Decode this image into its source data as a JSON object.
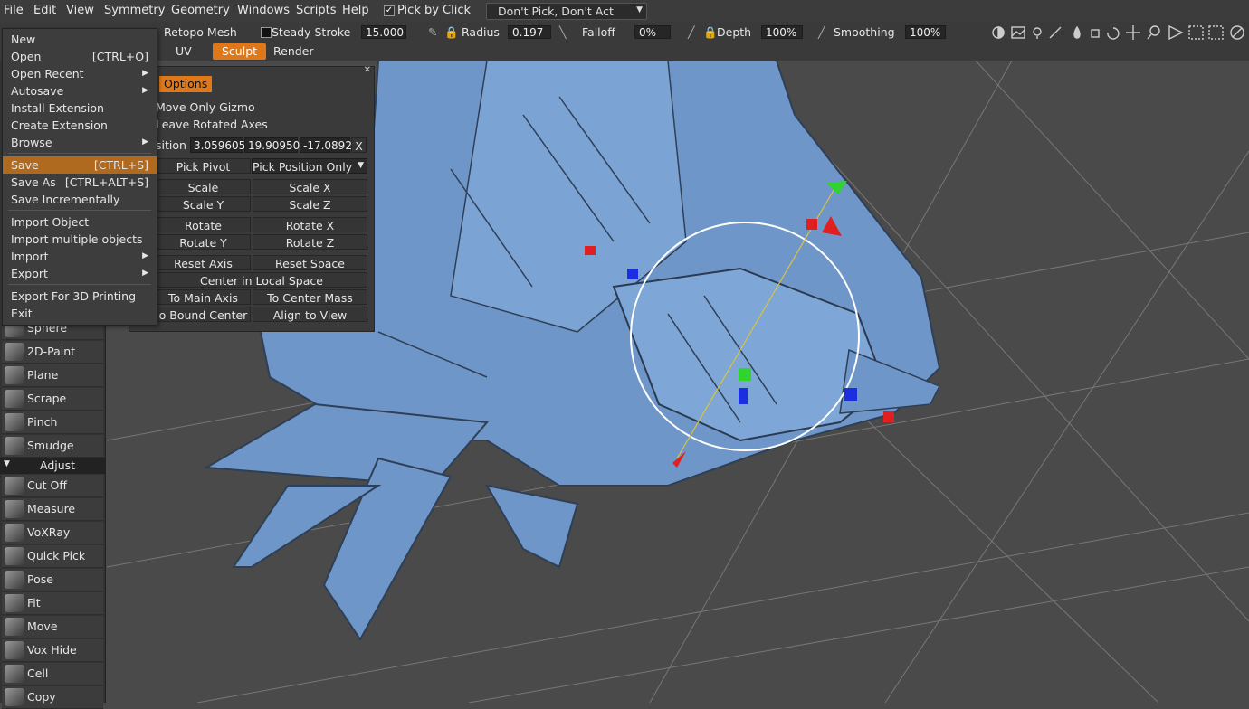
{
  "menubar": {
    "items": [
      "File",
      "Edit",
      "View",
      "Symmetry",
      "Geometry",
      "Windows",
      "Scripts",
      "Help"
    ],
    "pick_by_click": "Pick by Click",
    "pick_mode": "Don't Pick, Don't Act"
  },
  "toolbar": {
    "room_label": "Retopo Mesh",
    "steady_stroke_label": "Steady Stroke",
    "steady_stroke_value": "15.000",
    "radius_label": "Radius",
    "radius_value": "0.197",
    "falloff_label": "Falloff",
    "falloff_value": "0%",
    "depth_label": "Depth",
    "depth_value": "100%",
    "smoothing_label": "Smoothing",
    "smoothing_value": "100%"
  },
  "tabs": [
    "UV",
    "Sculpt",
    "Render"
  ],
  "active_tab": "Sculpt",
  "file_menu": {
    "items": [
      {
        "label": "New",
        "shortcut": ""
      },
      {
        "label": "Open",
        "shortcut": "[CTRL+O]"
      },
      {
        "label": "Open Recent",
        "shortcut": ""
      },
      {
        "label": "Autosave",
        "shortcut": ""
      },
      {
        "label": "Install Extension",
        "shortcut": ""
      },
      {
        "label": "Create Extension",
        "shortcut": ""
      },
      {
        "label": "Browse",
        "shortcut": ""
      },
      {
        "label": "Save",
        "shortcut": "[CTRL+S]"
      },
      {
        "label": "Save As",
        "shortcut": "[CTRL+ALT+S]"
      },
      {
        "label": "Save Incrementally",
        "shortcut": ""
      },
      {
        "label": "Import Object",
        "shortcut": ""
      },
      {
        "label": "Import multiple objects",
        "shortcut": ""
      },
      {
        "label": "Import",
        "shortcut": ""
      },
      {
        "label": "Export",
        "shortcut": ""
      },
      {
        "label": "Export For 3D Printing",
        "shortcut": ""
      },
      {
        "label": "Exit",
        "shortcut": ""
      }
    ]
  },
  "options_panel": {
    "title": "Options",
    "move_only_gizmo": "Move Only Gizmo",
    "leave_rotated_axes": "Leave Rotated Axes",
    "position_label": "sition",
    "position_x": "3.059605",
    "position_y": "19.90950",
    "position_z": "-17.0892",
    "position_clear": "X",
    "pick_pivot": "Pick Pivot",
    "pick_position_only": "Pick Position Only",
    "scale": "Scale",
    "scale_x": "Scale X",
    "scale_y": "Scale Y",
    "scale_z": "Scale Z",
    "rotate": "Rotate",
    "rotate_x": "Rotate X",
    "rotate_y": "Rotate Y",
    "rotate_z": "Rotate Z",
    "reset_axis": "Reset Axis",
    "reset_space": "Reset Space",
    "center_local": "Center in Local Space",
    "to_main_axis": "To Main Axis",
    "to_center_mass": "To Center Mass",
    "bound_center": "o Bound Center",
    "align_to_view": "Align to View"
  },
  "tools": {
    "items": [
      "Sphere",
      "2D-Paint",
      "Plane",
      "Scrape",
      "Pinch",
      "Smudge"
    ],
    "adjust_header": "Adjust",
    "adjust_items": [
      "Cut Off",
      "Measure",
      "VoXRay",
      "Quick Pick",
      "Pose",
      "Fit",
      "Move",
      "Vox Hide",
      "Cell",
      "Copy"
    ]
  },
  "colors": {
    "accent": "#e0781a",
    "menu_highlight": "#b06a20",
    "model_blue": "#6f96c8"
  },
  "icons": {
    "right_toolbar": [
      "half-circle-icon",
      "landscape-icon",
      "light-icon",
      "brush-icon",
      "drop-icon",
      "paint-bucket-icon",
      "rotate-icon",
      "move-icon",
      "zoom-icon",
      "play-icon",
      "all-icon",
      "pen-icon",
      "no-icon"
    ]
  }
}
